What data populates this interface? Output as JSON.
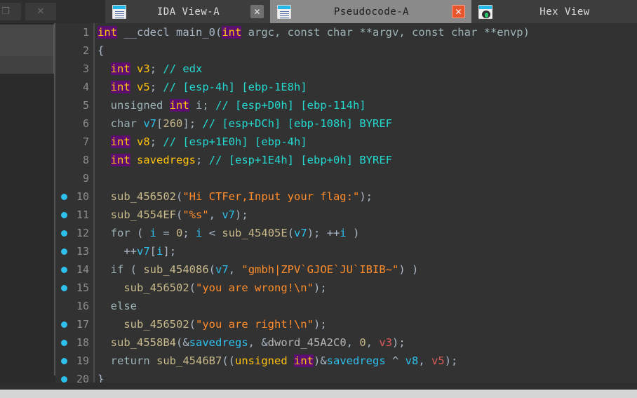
{
  "window": {
    "controls": [
      {
        "name": "restore-button",
        "glyph": "❐"
      },
      {
        "name": "close-button",
        "glyph": "✕"
      }
    ]
  },
  "tabs": [
    {
      "label": "IDA View-A",
      "icon": "document-list-icon",
      "active": false,
      "close_label": "✕",
      "close_style": "grey"
    },
    {
      "label": "Pseudocode-A",
      "icon": "document-list-icon",
      "active": true,
      "close_label": "✕",
      "close_style": "red"
    },
    {
      "label": "Hex View",
      "icon": "hex-view-icon",
      "active": false,
      "close_label": "",
      "close_style": "none"
    }
  ],
  "colors": {
    "editor_background": "#323232",
    "tab_active_background": "#8a8a8a",
    "tab_inactive_background": "#3d3d3d",
    "tabbar_background": "#4a4a4a",
    "breakpoint": "#2ec0ec",
    "linenumber": "#8d8d8d",
    "keyword": "#9cb3b8",
    "keyword_highlight_bg": "#5c0f70",
    "keyword_highlight_fg": "#ffc20e",
    "function_name": "#c8b98a",
    "string_literal": "#ff8c2b",
    "local_variable": "#2ec0ec",
    "register_variable": "#e05a5a",
    "comment": "#24d9d0",
    "global_symbol": "#b4b4b4"
  },
  "editor": {
    "lines": [
      {
        "number": "1",
        "breakpoint": false,
        "tokens": [
          {
            "t": "int",
            "c": "t-int"
          },
          {
            "t": " __cdecl ",
            "c": "t-plain"
          },
          {
            "t": "main_0",
            "c": "t-plain"
          },
          {
            "t": "(",
            "c": "t-plain"
          },
          {
            "t": "int",
            "c": "t-int"
          },
          {
            "t": " argc, ",
            "c": "t-kw"
          },
          {
            "t": "const char ",
            "c": "t-kw"
          },
          {
            "t": "**argv, ",
            "c": "t-kw"
          },
          {
            "t": "const char ",
            "c": "t-kw"
          },
          {
            "t": "**envp)",
            "c": "t-kw"
          }
        ]
      },
      {
        "number": "2",
        "breakpoint": false,
        "tokens": [
          {
            "t": "{",
            "c": "t-plain"
          }
        ]
      },
      {
        "number": "3",
        "breakpoint": false,
        "tokens": [
          {
            "t": "  ",
            "c": "t-plain"
          },
          {
            "t": "int",
            "c": "t-int"
          },
          {
            "t": " ",
            "c": "t-plain"
          },
          {
            "t": "v3",
            "c": "t-type"
          },
          {
            "t": "; ",
            "c": "t-plain"
          },
          {
            "t": "// edx",
            "c": "t-cmt"
          }
        ]
      },
      {
        "number": "4",
        "breakpoint": false,
        "tokens": [
          {
            "t": "  ",
            "c": "t-plain"
          },
          {
            "t": "int",
            "c": "t-int"
          },
          {
            "t": " ",
            "c": "t-plain"
          },
          {
            "t": "v5",
            "c": "t-type"
          },
          {
            "t": "; ",
            "c": "t-plain"
          },
          {
            "t": "// [esp-4h] [ebp-1E8h]",
            "c": "t-cmt"
          }
        ]
      },
      {
        "number": "5",
        "breakpoint": false,
        "tokens": [
          {
            "t": "  ",
            "c": "t-plain"
          },
          {
            "t": "unsigned ",
            "c": "t-kw"
          },
          {
            "t": "int",
            "c": "t-int"
          },
          {
            "t": " i; ",
            "c": "t-kw"
          },
          {
            "t": "// [esp+D0h] [ebp-114h]",
            "c": "t-cmt"
          }
        ]
      },
      {
        "number": "6",
        "breakpoint": false,
        "tokens": [
          {
            "t": "  ",
            "c": "t-plain"
          },
          {
            "t": "char ",
            "c": "t-kw"
          },
          {
            "t": "v7",
            "c": "t-var"
          },
          {
            "t": "[",
            "c": "t-plain"
          },
          {
            "t": "260",
            "c": "t-num"
          },
          {
            "t": "]; ",
            "c": "t-plain"
          },
          {
            "t": "// [esp+DCh] [ebp-108h] BYREF",
            "c": "t-cmt"
          }
        ]
      },
      {
        "number": "7",
        "breakpoint": false,
        "tokens": [
          {
            "t": "  ",
            "c": "t-plain"
          },
          {
            "t": "int",
            "c": "t-int"
          },
          {
            "t": " ",
            "c": "t-plain"
          },
          {
            "t": "v8",
            "c": "t-type"
          },
          {
            "t": "; ",
            "c": "t-plain"
          },
          {
            "t": "// [esp+1E0h] [ebp-4h]",
            "c": "t-cmt"
          }
        ]
      },
      {
        "number": "8",
        "breakpoint": false,
        "tokens": [
          {
            "t": "  ",
            "c": "t-plain"
          },
          {
            "t": "int",
            "c": "t-int"
          },
          {
            "t": " ",
            "c": "t-plain"
          },
          {
            "t": "savedregs",
            "c": "t-type"
          },
          {
            "t": "; ",
            "c": "t-plain"
          },
          {
            "t": "// [esp+1E4h] [ebp+0h] BYREF",
            "c": "t-cmt"
          }
        ]
      },
      {
        "number": "9",
        "breakpoint": false,
        "tokens": []
      },
      {
        "number": "10",
        "breakpoint": true,
        "tokens": [
          {
            "t": "  ",
            "c": "t-plain"
          },
          {
            "t": "sub_456502",
            "c": "t-fn"
          },
          {
            "t": "(",
            "c": "t-plain"
          },
          {
            "t": "\"Hi CTFer,Input your flag:\"",
            "c": "t-str"
          },
          {
            "t": ");",
            "c": "t-plain"
          }
        ]
      },
      {
        "number": "11",
        "breakpoint": true,
        "tokens": [
          {
            "t": "  ",
            "c": "t-plain"
          },
          {
            "t": "sub_4554EF",
            "c": "t-fn"
          },
          {
            "t": "(",
            "c": "t-plain"
          },
          {
            "t": "\"%s\"",
            "c": "t-str"
          },
          {
            "t": ", ",
            "c": "t-plain"
          },
          {
            "t": "v7",
            "c": "t-var"
          },
          {
            "t": ");",
            "c": "t-plain"
          }
        ]
      },
      {
        "number": "12",
        "breakpoint": true,
        "tokens": [
          {
            "t": "  ",
            "c": "t-plain"
          },
          {
            "t": "for ",
            "c": "t-kw"
          },
          {
            "t": "( ",
            "c": "t-plain"
          },
          {
            "t": "i",
            "c": "t-var"
          },
          {
            "t": " = ",
            "c": "t-plain"
          },
          {
            "t": "0",
            "c": "t-num"
          },
          {
            "t": "; ",
            "c": "t-plain"
          },
          {
            "t": "i",
            "c": "t-var"
          },
          {
            "t": " < ",
            "c": "t-plain"
          },
          {
            "t": "sub_45405E",
            "c": "t-fn"
          },
          {
            "t": "(",
            "c": "t-plain"
          },
          {
            "t": "v7",
            "c": "t-var"
          },
          {
            "t": "); ++",
            "c": "t-plain"
          },
          {
            "t": "i",
            "c": "t-var"
          },
          {
            "t": " )",
            "c": "t-plain"
          }
        ]
      },
      {
        "number": "13",
        "breakpoint": true,
        "tokens": [
          {
            "t": "    ++",
            "c": "t-plain"
          },
          {
            "t": "v7",
            "c": "t-var"
          },
          {
            "t": "[",
            "c": "t-plain"
          },
          {
            "t": "i",
            "c": "t-var"
          },
          {
            "t": "];",
            "c": "t-plain"
          }
        ]
      },
      {
        "number": "14",
        "breakpoint": true,
        "tokens": [
          {
            "t": "  ",
            "c": "t-plain"
          },
          {
            "t": "if ",
            "c": "t-kw"
          },
          {
            "t": "( ",
            "c": "t-plain"
          },
          {
            "t": "sub_454086",
            "c": "t-fn"
          },
          {
            "t": "(",
            "c": "t-plain"
          },
          {
            "t": "v7",
            "c": "t-var"
          },
          {
            "t": ", ",
            "c": "t-plain"
          },
          {
            "t": "\"gmbh|ZPV`GJOE`JU`IBIB~\"",
            "c": "t-str"
          },
          {
            "t": ") )",
            "c": "t-plain"
          }
        ]
      },
      {
        "number": "15",
        "breakpoint": true,
        "tokens": [
          {
            "t": "    ",
            "c": "t-plain"
          },
          {
            "t": "sub_456502",
            "c": "t-fn"
          },
          {
            "t": "(",
            "c": "t-plain"
          },
          {
            "t": "\"you are wrong!\\n\"",
            "c": "t-str"
          },
          {
            "t": ");",
            "c": "t-plain"
          }
        ]
      },
      {
        "number": "16",
        "breakpoint": false,
        "tokens": [
          {
            "t": "  ",
            "c": "t-plain"
          },
          {
            "t": "else",
            "c": "t-kw"
          }
        ]
      },
      {
        "number": "17",
        "breakpoint": true,
        "tokens": [
          {
            "t": "    ",
            "c": "t-plain"
          },
          {
            "t": "sub_456502",
            "c": "t-fn"
          },
          {
            "t": "(",
            "c": "t-plain"
          },
          {
            "t": "\"you are right!\\n\"",
            "c": "t-str"
          },
          {
            "t": ");",
            "c": "t-plain"
          }
        ]
      },
      {
        "number": "18",
        "breakpoint": true,
        "tokens": [
          {
            "t": "  ",
            "c": "t-plain"
          },
          {
            "t": "sub_4558B4",
            "c": "t-fn"
          },
          {
            "t": "(&",
            "c": "t-plain"
          },
          {
            "t": "savedregs",
            "c": "t-var"
          },
          {
            "t": ", &",
            "c": "t-plain"
          },
          {
            "t": "dword_45A2C0",
            "c": "t-glob"
          },
          {
            "t": ", ",
            "c": "t-plain"
          },
          {
            "t": "0",
            "c": "t-num"
          },
          {
            "t": ", ",
            "c": "t-plain"
          },
          {
            "t": "v3",
            "c": "t-var2"
          },
          {
            "t": ");",
            "c": "t-plain"
          }
        ]
      },
      {
        "number": "19",
        "breakpoint": true,
        "tokens": [
          {
            "t": "  ",
            "c": "t-plain"
          },
          {
            "t": "return ",
            "c": "t-kw"
          },
          {
            "t": "sub_4546B7",
            "c": "t-fn"
          },
          {
            "t": "((",
            "c": "t-plain"
          },
          {
            "t": "unsigned ",
            "c": "t-type"
          },
          {
            "t": "int",
            "c": "t-int"
          },
          {
            "t": ")&",
            "c": "t-plain"
          },
          {
            "t": "savedregs",
            "c": "t-var"
          },
          {
            "t": " ^ ",
            "c": "t-plain"
          },
          {
            "t": "v8",
            "c": "t-var"
          },
          {
            "t": ", ",
            "c": "t-plain"
          },
          {
            "t": "v5",
            "c": "t-var2"
          },
          {
            "t": ");",
            "c": "t-plain"
          }
        ]
      },
      {
        "number": "20",
        "breakpoint": true,
        "tokens": [
          {
            "t": "}",
            "c": "t-plain"
          }
        ]
      }
    ]
  }
}
